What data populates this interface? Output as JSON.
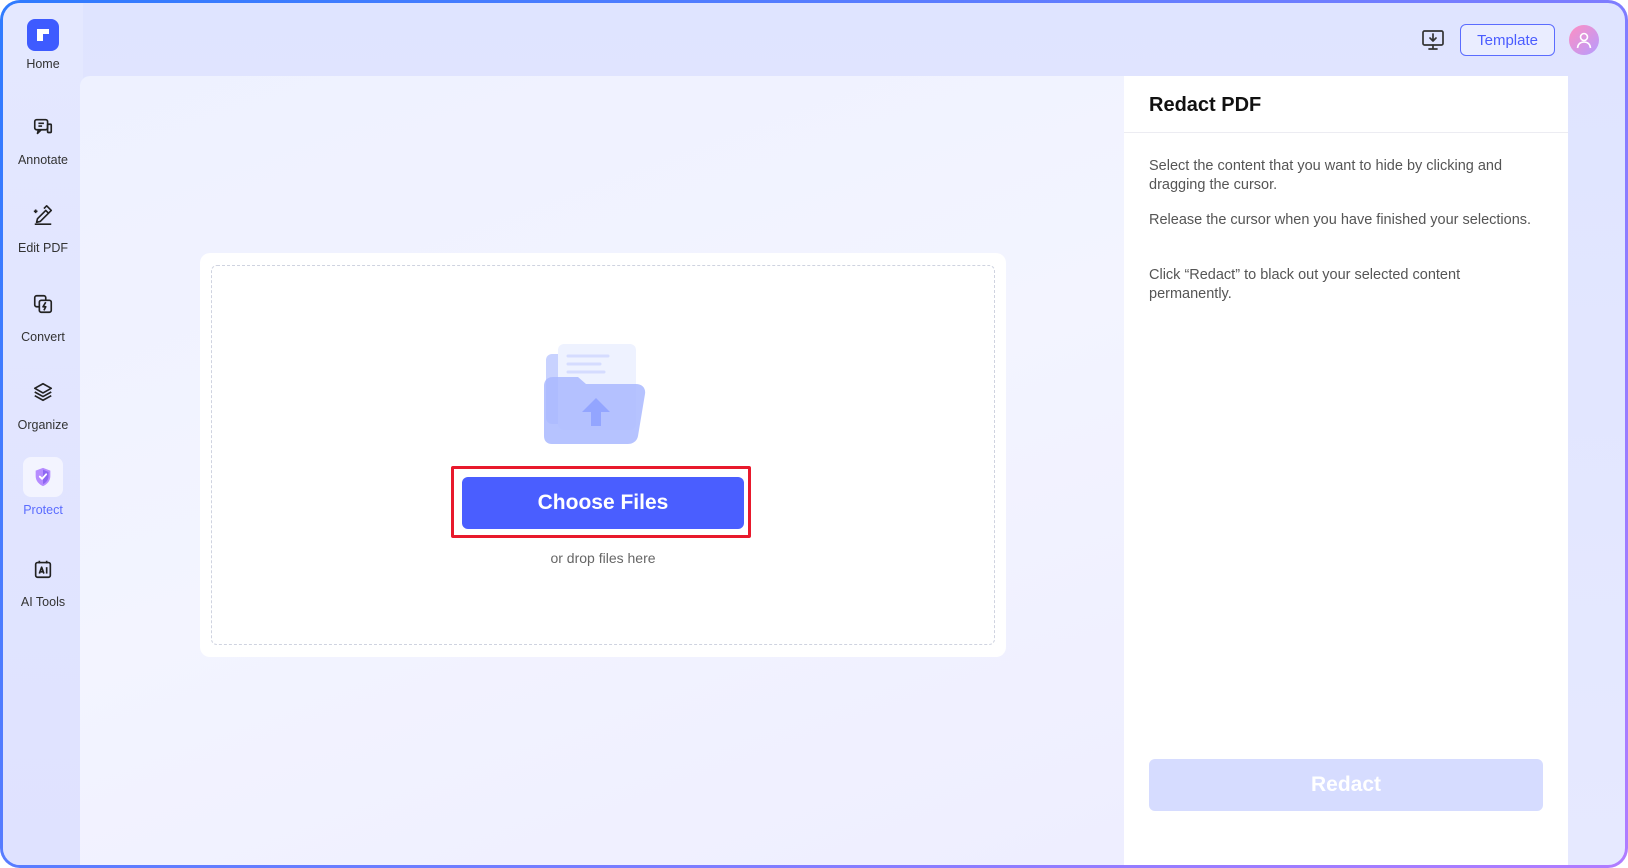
{
  "sidebar": {
    "items": [
      {
        "label": "Home",
        "icon": "logo-icon"
      },
      {
        "label": "Annotate",
        "icon": "annotate-icon"
      },
      {
        "label": "Edit PDF",
        "icon": "edit-pdf-icon"
      },
      {
        "label": "Convert",
        "icon": "convert-icon"
      },
      {
        "label": "Organize",
        "icon": "organize-icon"
      },
      {
        "label": "Protect",
        "icon": "shield-icon",
        "active": true
      },
      {
        "label": "AI Tools",
        "icon": "ai-tools-icon"
      }
    ]
  },
  "header": {
    "template_label": "Template",
    "download_icon": "desktop-download-icon",
    "avatar_icon": "user-avatar-icon"
  },
  "upload": {
    "button_label": "Choose Files",
    "hint": "or drop files here"
  },
  "panel": {
    "title": "Redact PDF",
    "paragraphs": [
      "Select the content that you want to hide by clicking and dragging the cursor.",
      "Release the cursor when you have finished your selections.",
      "Click “Redact” to black out your selected content permanently."
    ],
    "action_label": "Redact"
  },
  "colors": {
    "accent": "#4a5eff",
    "highlight": "#e8192c",
    "disabled_button": "#d6dcff"
  }
}
